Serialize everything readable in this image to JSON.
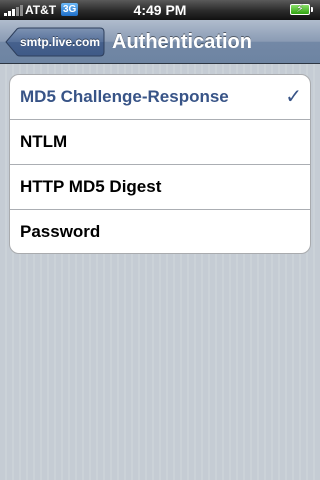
{
  "status_bar": {
    "carrier": "AT&T",
    "network": "3G",
    "time": "4:49 PM",
    "battery_icon": "charging-battery-icon"
  },
  "nav_bar": {
    "back_label": "smtp.live.com",
    "title": "Authentication"
  },
  "options": [
    {
      "label": "MD5 Challenge-Response",
      "selected": true
    },
    {
      "label": "NTLM",
      "selected": false
    },
    {
      "label": "HTTP MD5 Digest",
      "selected": false
    },
    {
      "label": "Password",
      "selected": false
    }
  ],
  "colors": {
    "selected_text": "#385487",
    "background": "#c5ccd4",
    "nav_bar": "#8a9bb4"
  }
}
